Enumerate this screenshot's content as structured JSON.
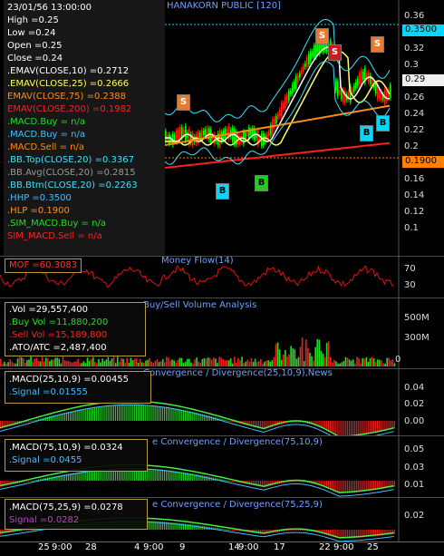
{
  "main": {
    "title": "HANAKORN PUBLIC [120]",
    "info": {
      "date": "23/01/56 13:00:00",
      "high": "High =0.25",
      "low": "Low =0.24",
      "open": "Open =0.25",
      "close": "Close =0.24",
      "emav10": ".EMAV(CLOSE,10) =0.2712",
      "emav25": ".EMAV(CLOSE,25) =0.2666",
      "emav75": "EMAV(CLOSE,75) =0.2388",
      "emav200": "EMAV(CLOSE,200) =0.1982",
      "macd_buy1": ".MACD.Buy = n/a",
      ".macd_sell1": "MACD.Sell = n/a",
      "macd_buy2": ".MACD.Buy = n/a",
      "macd_sell2": ".MACD.Sell = n/a",
      "bb_top": ".BB.Top(CLOSE,20) =0.3367",
      "bb_avg": ".BB.Avg(CLOSE,20) =0.2815",
      "bb_btm": ".BB.Btm(CLOSE,20) =0.2263",
      "hhp": ".HHP =0.3500",
      "hlp": ".HLP =0.1900",
      "sim_buy": ".SIM_MACD.Buy = n/a",
      "sim_sell": "SIM_MACD.Sell = n/a"
    },
    "y_ticks": [
      "0.36",
      "0.34",
      "0.32",
      "0.3",
      "0.28",
      "0.26",
      "0.24",
      "0.22",
      "0.2",
      "0.18",
      "0.16",
      "0.14",
      "0.12",
      "0.1"
    ],
    "tags": {
      "hhp": "0.3500",
      "last": "0.29",
      "hlp": "0.1900"
    },
    "markers": {
      "s1": "S",
      "s2": "S",
      "s3": "S",
      "s4": "S",
      "b1": "B",
      "b2": "B",
      "b3": "B",
      "b4": "B"
    }
  },
  "mfi": {
    "title": "Money Flow(14)",
    "info": "MOF =60.3083",
    "y_ticks": [
      "70",
      "30"
    ]
  },
  "volume": {
    "title": "Buy/Sell Volume Analysis",
    "info": {
      "vol": ".Vol =29,557,400",
      "buy": ".Buy Vol =11,880,200",
      "sell": ".Sell Vol =15,189,800",
      "atc": ".ATO/ATC =2,487,400"
    },
    "y_ticks": [
      "500M",
      "300M",
      "100M",
      "0"
    ]
  },
  "macd1": {
    "title": "Convergence / Divergence(25,10,9),News",
    "info": {
      "macd": ".MACD(25,10,9) =0.00455",
      "signal": ".Signal =0.01555"
    },
    "y_ticks": [
      "0.04",
      "0.02",
      "0.00"
    ]
  },
  "macd2": {
    "title": "e Convergence / Divergence(75,10,9)",
    "info": {
      "macd": ".MACD(75,10,9) =0.0324",
      "signal": ".Signal =0.0455"
    },
    "y_ticks": [
      "0.05",
      "0.03",
      "0.01"
    ]
  },
  "macd3": {
    "title": "e Convergence / Divergence(75,25,9)",
    "info": {
      "macd": ".MACD(75,25,9) =0.0278",
      "signal": "Signal =0.0282"
    },
    "y_ticks": [
      "0.02"
    ]
  },
  "xaxis": {
    "labels": [
      "25",
      "9:00",
      "28",
      "4",
      "9:00",
      "9",
      "14",
      "9:00",
      "17",
      "22",
      "9:00",
      "25"
    ]
  },
  "colors": {
    "bg": "#000000",
    "candle_up": "#00ff00",
    "ema10": "#ffffff",
    "ema25": "#ffff66",
    "ema75": "#ff8c1a",
    "ema200": "#ff2020",
    "bb": "#40e0ff",
    "mfi": "#e01010",
    "hhp_tag": "#00d8ff",
    "hlp_tag": "#ff8000"
  }
}
